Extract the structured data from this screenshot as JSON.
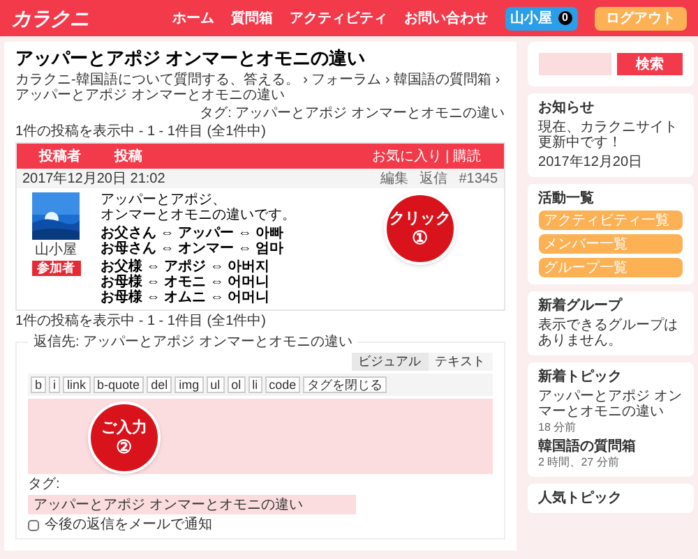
{
  "header": {
    "logo": "カラクニ",
    "nav": [
      "ホーム",
      "質問箱",
      "アクティビティ",
      "お問い合わせ"
    ],
    "user": {
      "name": "山小屋",
      "badge": "0"
    },
    "logout": "ログアウト"
  },
  "page": {
    "title": "アッパーとアポジ オンマーとオモニの違い",
    "breadcrumb": "カラクニ-韓国語について質問する、答える。 › フォーラム › 韓国語の質問箱 › アッパーとアポジ オンマーとオモニの違い",
    "tags_line": "タグ: アッパーとアポジ オンマーとオモニの違い",
    "count_top": "1件の投稿を表示中 - 1 - 1件目 (全1件中)",
    "count_bottom": "1件の投稿を表示中 - 1 - 1件目 (全1件中)"
  },
  "table": {
    "columns": [
      "投稿者",
      "投稿"
    ],
    "actions": "お気に入り | 購読"
  },
  "post": {
    "date": "2017年12月20日 21:02",
    "links": [
      "編集",
      "返信"
    ],
    "number": "#1345",
    "author": "山小屋",
    "role": "参加者",
    "paragraphs": [
      [
        "アッパーとアポジ、",
        "オンマーとオモニの違いです。"
      ],
      [
        "お父さん ⇔ アッパー ⇔ 아빠",
        "お母さん ⇔ オンマー ⇔ 엄마"
      ],
      [
        "お父様 ⇔ アポジ ⇔ 아버지",
        "お母様 ⇔ オモニ ⇔ 어머니",
        "お母様 ⇔ オムニ ⇔ 어머니"
      ]
    ]
  },
  "reply": {
    "legend": "返信先: アッパーとアポジ オンマーとオモニの違い",
    "modes": [
      {
        "label": "ビジュアル",
        "selected": false
      },
      {
        "label": "テキスト",
        "selected": true
      }
    ],
    "toolbar": [
      "b",
      "i",
      "link",
      "b-quote",
      "del",
      "img",
      "ul",
      "ol",
      "li",
      "code",
      "タグを閉じる"
    ],
    "tag_label": "タグ:",
    "tag_value": "アッパーとアポジ オンマーとオモニの違い",
    "notify": {
      "label": "今後の返信をメールで通知",
      "checked": false
    }
  },
  "callouts": [
    {
      "text": "クリック",
      "number": "①"
    },
    {
      "text": "ご入力",
      "number": "②"
    }
  ],
  "sidebar": {
    "search_button": "検索",
    "notice": {
      "title": "お知らせ",
      "body": "現在、カラクニサイト更新中です！",
      "date": "2017年12月20日"
    },
    "activity": {
      "title": "活動一覧",
      "links": [
        "アクティビティ一覧",
        "メンバー一覧",
        "グループ一覧"
      ]
    },
    "groups": {
      "title": "新着グループ",
      "body": "表示できるグループはありません。"
    },
    "topics": {
      "title": "新着トピック",
      "items": [
        {
          "title": "アッパーとアポジ オンマーとオモニの違い",
          "time": "18 分前"
        },
        {
          "title": "韓国語の質問箱",
          "time": "2 時間、27 分前"
        }
      ]
    },
    "popular": {
      "title": "人気トピック"
    }
  }
}
